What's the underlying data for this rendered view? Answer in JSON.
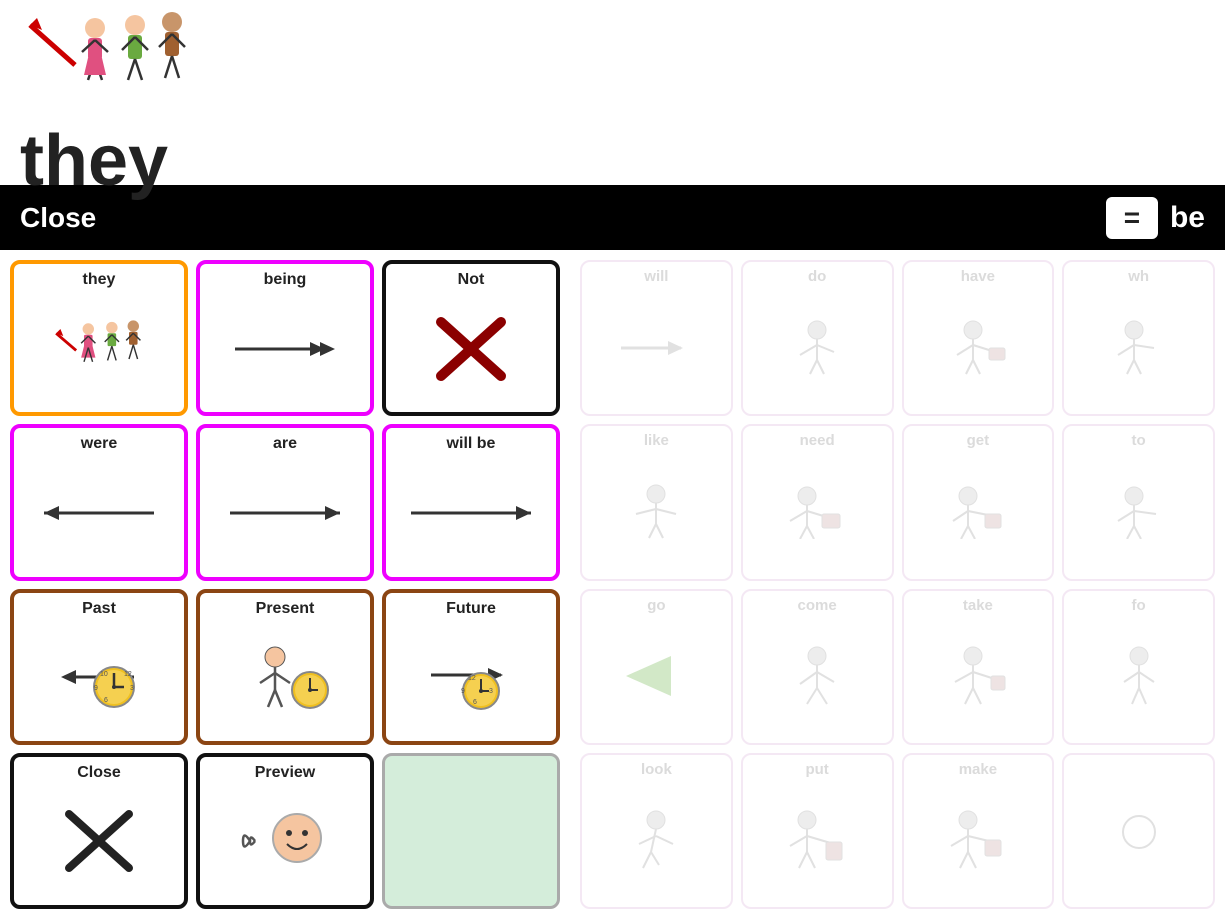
{
  "top": {
    "word": "they"
  },
  "toolbar": {
    "close_label": "Close",
    "be_label": "be",
    "equals_symbol": "="
  },
  "left_panel": {
    "cards": [
      {
        "id": "they",
        "label": "they",
        "border": "orange",
        "visual": "they-figure"
      },
      {
        "id": "being",
        "label": "being",
        "border": "magenta",
        "visual": "arrow-double"
      },
      {
        "id": "not",
        "label": "Not",
        "border": "black",
        "visual": "x-red"
      },
      {
        "id": "were",
        "label": "were",
        "border": "magenta",
        "visual": "arrow-left"
      },
      {
        "id": "are",
        "label": "are",
        "border": "magenta",
        "visual": "arrow-right-solid"
      },
      {
        "id": "will-be",
        "label": "will be",
        "border": "magenta",
        "visual": "arrow-right-long"
      },
      {
        "id": "past",
        "label": "Past",
        "border": "brown",
        "visual": "clock-left"
      },
      {
        "id": "present",
        "label": "Present",
        "border": "brown",
        "visual": "person-clock"
      },
      {
        "id": "future",
        "label": "Future",
        "border": "brown",
        "visual": "clock-right"
      },
      {
        "id": "close",
        "label": "Close",
        "border": "black",
        "visual": "x-black"
      },
      {
        "id": "preview",
        "label": "Preview",
        "border": "black",
        "visual": "speaking-person"
      },
      {
        "id": "empty",
        "label": "",
        "border": "gray",
        "visual": "empty"
      }
    ]
  },
  "right_panel": {
    "cards": [
      {
        "id": "will",
        "label": "will",
        "visual": "arrow-right-faded"
      },
      {
        "id": "do",
        "label": "do",
        "visual": "person-pointing"
      },
      {
        "id": "have",
        "label": "have",
        "visual": "person-holding"
      },
      {
        "id": "wh",
        "label": "wh",
        "visual": "person-gesture"
      },
      {
        "id": "like",
        "label": "like",
        "visual": "person-arms"
      },
      {
        "id": "need",
        "label": "need",
        "visual": "person-reach"
      },
      {
        "id": "get",
        "label": "get",
        "visual": "person-box"
      },
      {
        "id": "to",
        "label": "to",
        "visual": "person-gesture2"
      },
      {
        "id": "go",
        "label": "go",
        "visual": "arrow-green"
      },
      {
        "id": "come",
        "label": "come",
        "visual": "person-walk"
      },
      {
        "id": "take",
        "label": "take",
        "visual": "person-hold"
      },
      {
        "id": "fo",
        "label": "fo",
        "visual": "person-small"
      },
      {
        "id": "look",
        "label": "look",
        "visual": "person-walk2"
      },
      {
        "id": "put",
        "label": "put",
        "visual": "person-carry"
      },
      {
        "id": "make",
        "label": "make",
        "visual": "person-make"
      },
      {
        "id": "r4",
        "label": "",
        "visual": "circle-empty"
      }
    ]
  }
}
